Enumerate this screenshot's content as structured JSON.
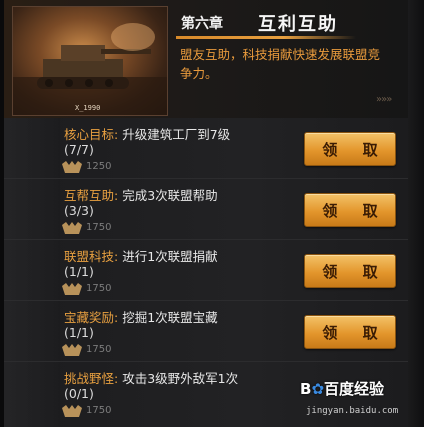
{
  "header": {
    "chapter_number": "第六章",
    "chapter_title": "互利互助",
    "description": "盟友互助，科技捐献快速发展联盟竞争力。",
    "image_code": "X_1990"
  },
  "claim_label": "领 取",
  "tasks": [
    {
      "category": "核心目标:",
      "description": "升级建筑工厂到7级",
      "progress": "(7/7)",
      "reward": "1250"
    },
    {
      "category": "互帮互助:",
      "description": "完成3次联盟帮助",
      "progress": "(3/3)",
      "reward": "1750"
    },
    {
      "category": "联盟科技:",
      "description": "进行1次联盟捐献",
      "progress": "(1/1)",
      "reward": "1750"
    },
    {
      "category": "宝藏奖励:",
      "description": "挖掘1次联盟宝藏",
      "progress": "(1/1)",
      "reward": "1750"
    },
    {
      "category": "挑战野怪:",
      "description": "攻击3级野外敌军1次",
      "progress": "(0/1)",
      "reward": "1750"
    }
  ],
  "watermark": {
    "logo_left": "B",
    "logo_right": "百度经验",
    "url": "jingyan.baidu.com"
  },
  "colors": {
    "accent_orange": "#e8a040",
    "button_gold": "#e3962c"
  },
  "icons": {
    "reward": "honor-badge-icon",
    "header_deco": "double-arrow-icon"
  }
}
